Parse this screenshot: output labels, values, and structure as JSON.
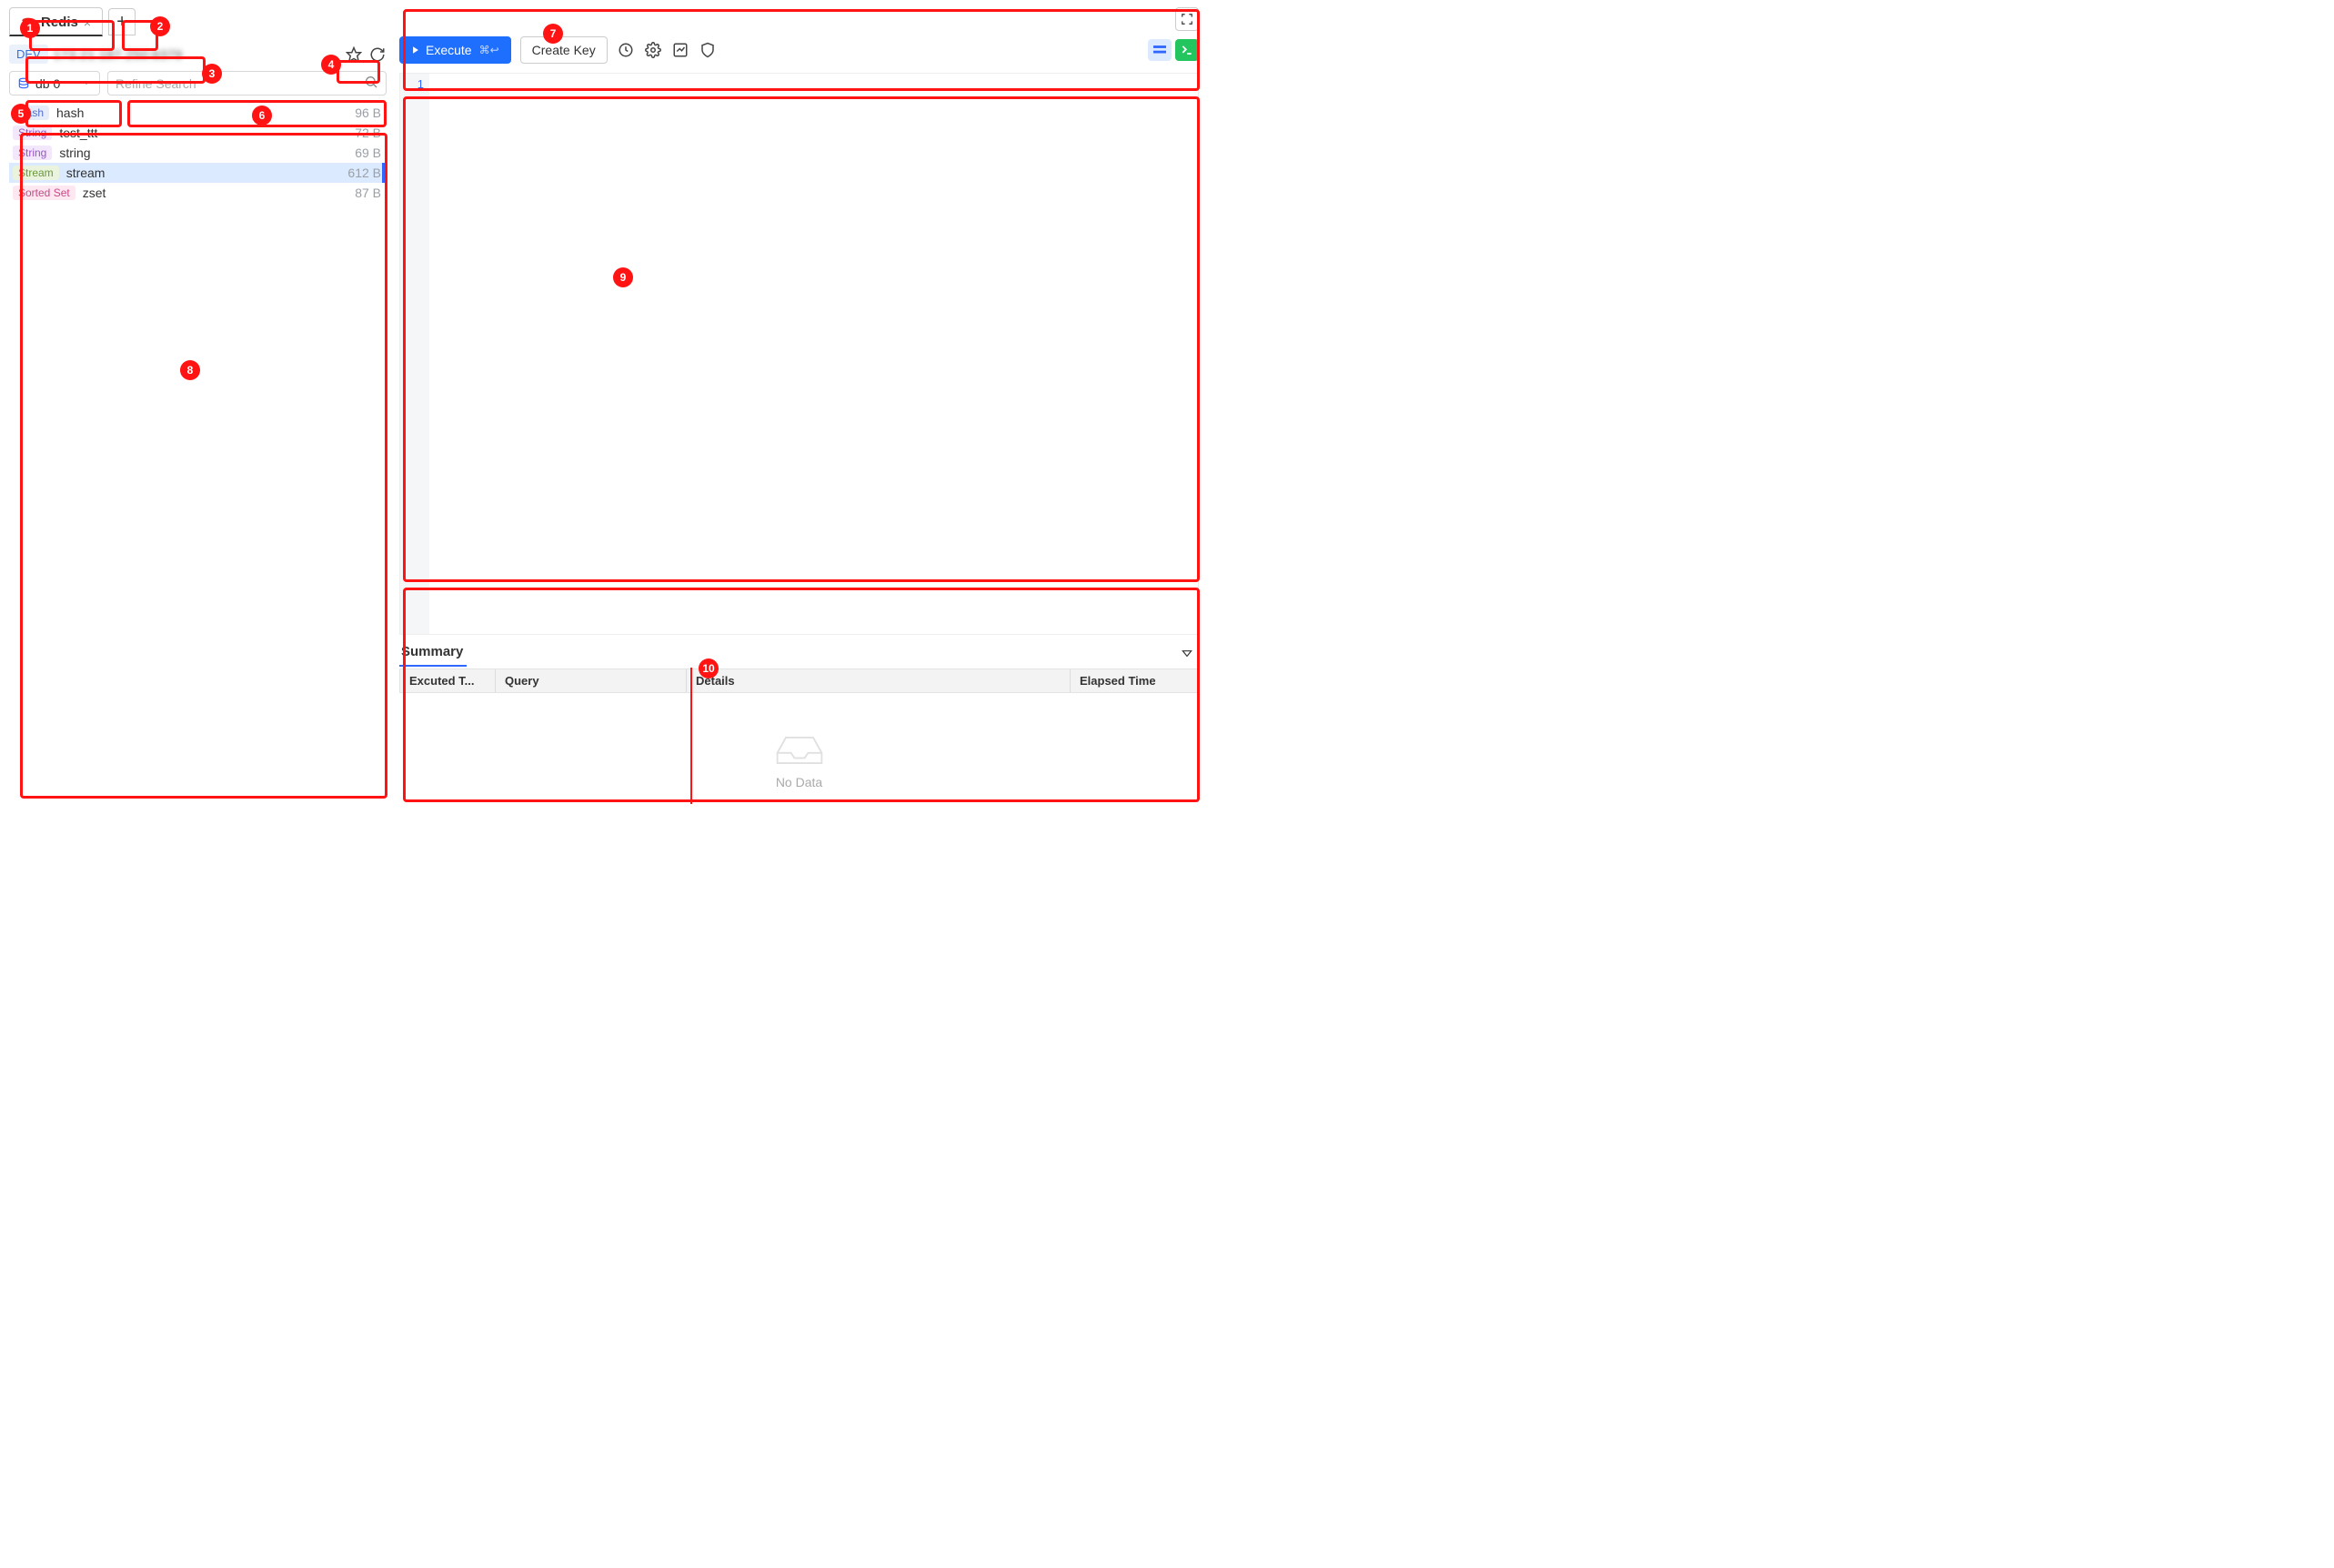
{
  "tab": {
    "label": "Redis",
    "close": "×",
    "add": "+"
  },
  "connection": {
    "env": "DEV",
    "host": "173.21.187.250:6379"
  },
  "actions": {
    "star_icon": "star-icon",
    "refresh_icon": "refresh-icon"
  },
  "db_select": {
    "label": "db 0"
  },
  "search": {
    "placeholder": "Refine Search"
  },
  "keys": [
    {
      "type": "Hash",
      "type_class": "kt-hash",
      "name": "hash",
      "size": "96 B",
      "selected": false
    },
    {
      "type": "String",
      "type_class": "kt-string",
      "name": "test_ttt",
      "size": "72 B",
      "selected": false
    },
    {
      "type": "String",
      "type_class": "kt-string",
      "name": "string",
      "size": "69 B",
      "selected": false
    },
    {
      "type": "Stream",
      "type_class": "kt-stream",
      "name": "stream",
      "size": "612 B",
      "selected": true
    },
    {
      "type": "Sorted Set",
      "type_class": "kt-sortedset",
      "name": "zset",
      "size": "87 B",
      "selected": false
    }
  ],
  "toolbar": {
    "execute": "Execute",
    "shortcut": "⌘↩",
    "create_key": "Create Key"
  },
  "editor": {
    "line1": "1"
  },
  "summary": {
    "title": "Summary",
    "cols": {
      "executed": "Excuted T...",
      "query": "Query",
      "details": "Details",
      "elapsed": "Elapsed Time"
    },
    "no_data": "No Data"
  },
  "badges": [
    "1",
    "2",
    "3",
    "4",
    "5",
    "6",
    "7",
    "8",
    "9",
    "10"
  ]
}
